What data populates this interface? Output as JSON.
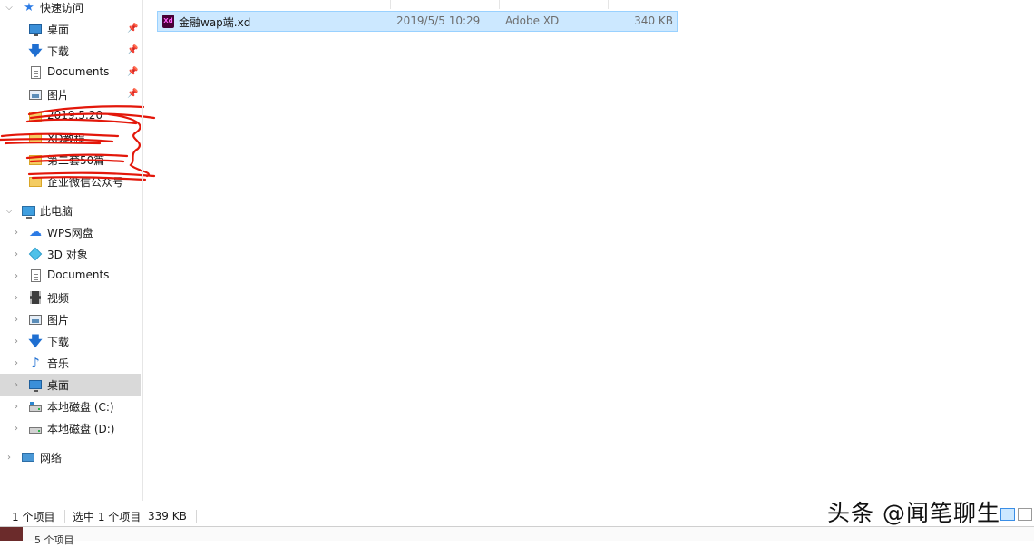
{
  "nav": {
    "quick_access": "快速访问",
    "pinned": [
      {
        "label": "桌面",
        "icon": "desktop-icon"
      },
      {
        "label": "下载",
        "icon": "download-icon"
      },
      {
        "label": "Documents",
        "icon": "document-icon"
      },
      {
        "label": "图片",
        "icon": "pictures-icon"
      }
    ],
    "folders": [
      {
        "label": "2019.5.20"
      },
      {
        "label": "XD教程"
      },
      {
        "label": "第二套50篇"
      },
      {
        "label": "企业微信公众号"
      }
    ],
    "this_pc": "此电脑",
    "pc_items": [
      {
        "label": "WPS网盘",
        "icon": "cloud-icon"
      },
      {
        "label": "3D 对象",
        "icon": "3d-objects-icon"
      },
      {
        "label": "Documents",
        "icon": "document-icon"
      },
      {
        "label": "视频",
        "icon": "video-icon"
      },
      {
        "label": "图片",
        "icon": "pictures-icon"
      },
      {
        "label": "下载",
        "icon": "download-icon"
      },
      {
        "label": "音乐",
        "icon": "music-icon"
      },
      {
        "label": "桌面",
        "icon": "desktop-icon"
      },
      {
        "label": "本地磁盘 (C:)",
        "icon": "drive-c-icon"
      },
      {
        "label": "本地磁盘 (D:)",
        "icon": "drive-d-icon"
      }
    ],
    "network": "网络"
  },
  "file": {
    "name": "金融wap端.xd",
    "date": "2019/5/5 10:29",
    "type": "Adobe XD",
    "size": "340 KB",
    "icon_text": "Xd"
  },
  "status": {
    "items": "1 个项目",
    "selected": "选中 1 个项目",
    "selected_size": "339 KB"
  },
  "bottom": {
    "items": "5 个项目"
  },
  "watermark": "头条 @闻笔聊生"
}
